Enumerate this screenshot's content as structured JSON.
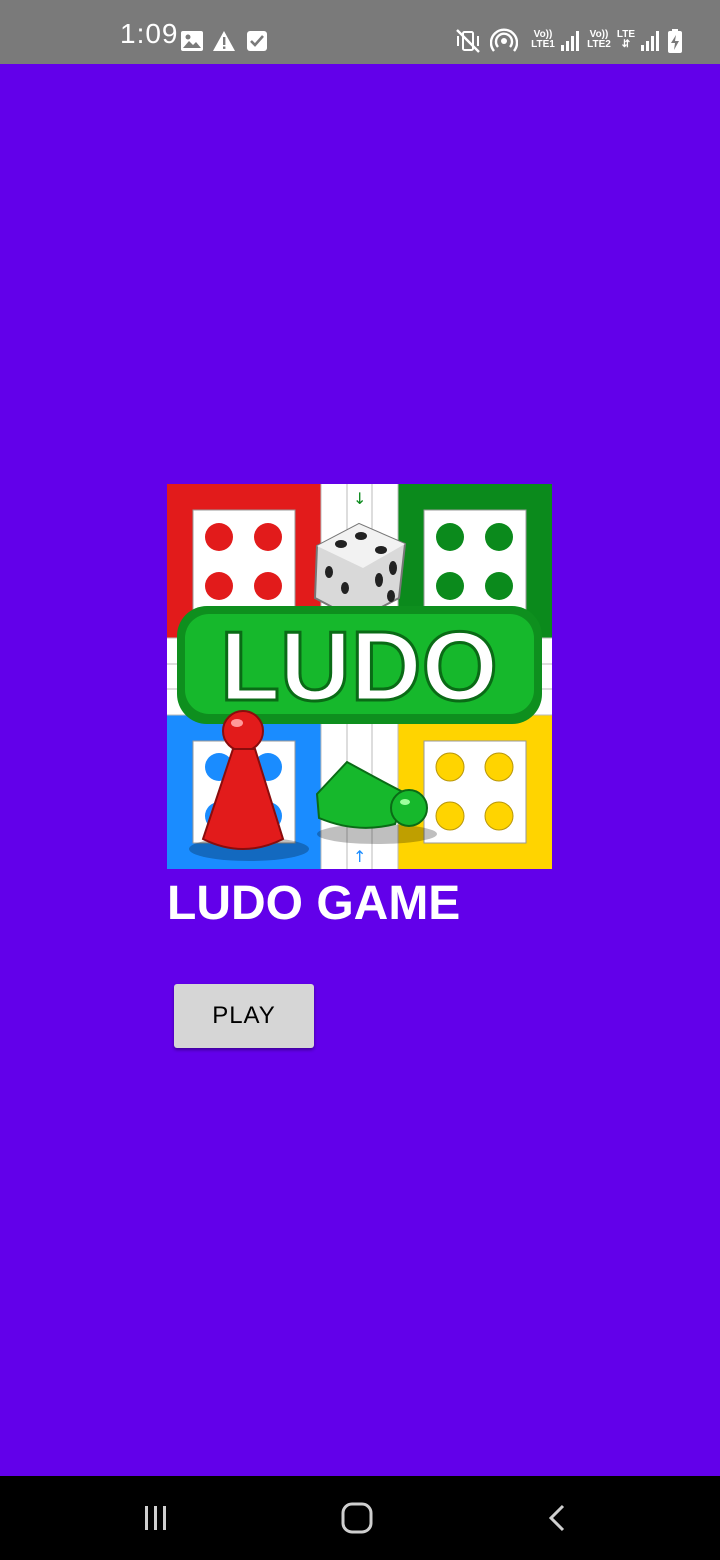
{
  "status_bar": {
    "time": "1:09",
    "sim1_label_top": "Vo))",
    "sim1_label_bottom": "LTE1",
    "sim2_label_top": "Vo))",
    "sim2_label_bottom": "LTE2",
    "data_label": "LTE",
    "icons_left": [
      "image-icon",
      "warning-icon",
      "checkbox-icon"
    ],
    "icons_right": [
      "mute-icon",
      "hotspot-icon",
      "signal-icon",
      "signal-icon",
      "battery-charging-icon"
    ]
  },
  "app": {
    "background_color": "#6200ea",
    "logo_text": "LUDO",
    "title": "LUDO GAME",
    "play_label": "PLAY"
  },
  "nav_bar": {
    "buttons": [
      "recents-icon",
      "home-icon",
      "back-icon"
    ]
  }
}
